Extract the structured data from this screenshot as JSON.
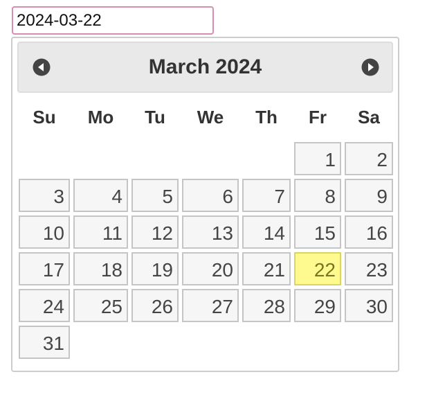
{
  "date_input": {
    "value": "2024-03-22"
  },
  "datepicker": {
    "title": "March 2024",
    "prev_icon": "triangle-left-circle-icon",
    "next_icon": "triangle-right-circle-icon",
    "weekdays": [
      "Su",
      "Mo",
      "Tu",
      "We",
      "Th",
      "Fr",
      "Sa"
    ],
    "weeks": [
      [
        "",
        "",
        "",
        "",
        "",
        "1",
        "2"
      ],
      [
        "3",
        "4",
        "5",
        "6",
        "7",
        "8",
        "9"
      ],
      [
        "10",
        "11",
        "12",
        "13",
        "14",
        "15",
        "16"
      ],
      [
        "17",
        "18",
        "19",
        "20",
        "21",
        "22",
        "23"
      ],
      [
        "24",
        "25",
        "26",
        "27",
        "28",
        "29",
        "30"
      ],
      [
        "31",
        "",
        "",
        "",
        "",
        "",
        ""
      ]
    ],
    "selected_day": "22",
    "colors": {
      "input_border": "#d98bb0",
      "header_bg": "#e9e9e9",
      "day_bg": "#f6f6f6",
      "day_border": "#c5c5c5",
      "selected_bg": "#fffa90",
      "selected_border": "#dad55e"
    }
  }
}
